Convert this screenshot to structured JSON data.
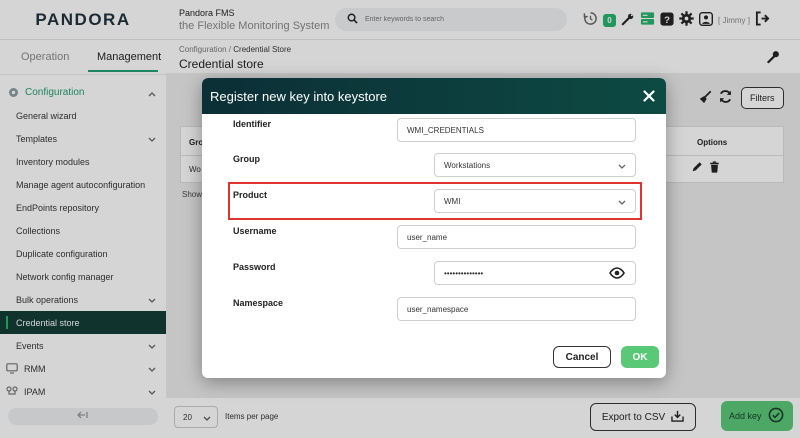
{
  "header": {
    "logo": "PANDORA",
    "product_line1": "Pandora FMS",
    "product_line2": "the Flexible Monitoring System",
    "search_placeholder": "Enter keywords to search",
    "notification_count": "0",
    "user_label": "[ Jimmy ]"
  },
  "sidebar": {
    "tabs": [
      {
        "label": "Operation"
      },
      {
        "label": "Management"
      }
    ],
    "section": "Configuration",
    "items": [
      {
        "label": "General wizard"
      },
      {
        "label": "Templates"
      },
      {
        "label": "Inventory modules"
      },
      {
        "label": "Manage agent autoconfiguration"
      },
      {
        "label": "EndPoints repository"
      },
      {
        "label": "Collections"
      },
      {
        "label": "Duplicate configuration"
      },
      {
        "label": "Network config manager"
      },
      {
        "label": "Bulk operations"
      },
      {
        "label": "Credential store"
      },
      {
        "label": "Events"
      },
      {
        "label": "RMM"
      },
      {
        "label": "IPAM"
      }
    ]
  },
  "main": {
    "breadcrumb_parent": "Configuration /",
    "breadcrumb_current": "Credential Store",
    "title": "Credential store",
    "filters_label": "Filters",
    "table": {
      "col_group": "Gro",
      "col_options": "Options",
      "row_group": "Wo"
    },
    "show_text": "Show",
    "pager_value": "20",
    "items_per_page": "Items per page",
    "export_csv_label": "Export to CSV",
    "add_key_label": "Add key"
  },
  "modal": {
    "title": "Register new key into keystore",
    "identifier_label": "Identifier",
    "identifier_value": "WMI_CREDENTIALS",
    "group_label": "Group",
    "group_value": "Workstations",
    "product_label": "Product",
    "product_value": "WMI",
    "username_label": "Username",
    "username_value": "user_name",
    "password_label": "Password",
    "password_value": "••••••••••••••",
    "namespace_label": "Namespace",
    "namespace_value": "user_namespace",
    "cancel_label": "Cancel",
    "ok_label": "OK"
  },
  "colors": {
    "accent": "#1f9e70",
    "sidebar_active": "#0f3a34",
    "button_green": "#59c977",
    "highlight_red": "#e0352f"
  }
}
